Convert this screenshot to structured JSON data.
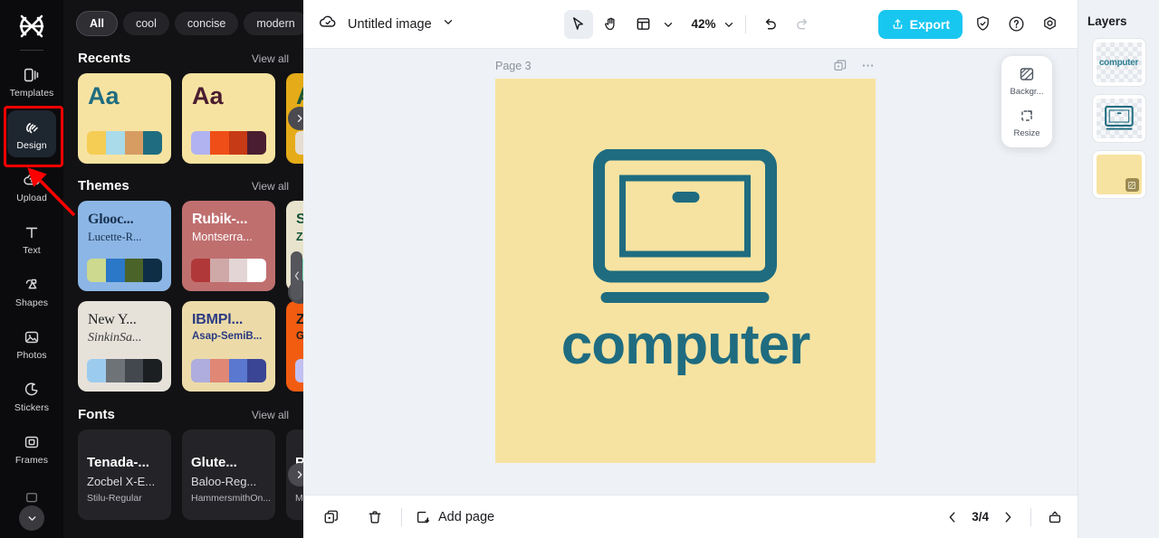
{
  "app": {
    "brand_icon": "capcut-logo-icon"
  },
  "rail": {
    "items": [
      {
        "label": "Templates",
        "icon": "templates-icon",
        "active": false
      },
      {
        "label": "Design",
        "icon": "design-icon",
        "active": true
      },
      {
        "label": "Upload",
        "icon": "upload-cloud-icon",
        "active": false
      },
      {
        "label": "Text",
        "icon": "text-icon",
        "active": false
      },
      {
        "label": "Shapes",
        "icon": "shapes-icon",
        "active": false
      },
      {
        "label": "Photos",
        "icon": "photos-icon",
        "active": false
      },
      {
        "label": "Stickers",
        "icon": "stickers-icon",
        "active": false
      },
      {
        "label": "Frames",
        "icon": "frames-icon",
        "active": false
      }
    ],
    "more_icon": "chevron-down-icon"
  },
  "panel": {
    "chips": [
      {
        "label": "All",
        "selected": true
      },
      {
        "label": "cool",
        "selected": false
      },
      {
        "label": "concise",
        "selected": false
      },
      {
        "label": "modern",
        "selected": false
      }
    ],
    "chip_expand_icon": "chevron-down-icon",
    "sections": {
      "recents": {
        "title": "Recents",
        "view_all": "View all",
        "cards": [
          {
            "sample": "Aa",
            "bg": "#f7e3a1",
            "text_color": "#1f6c80",
            "swatches": [
              "#f5cd54",
              "#a9dbea",
              "#d79c62",
              "#1f6c80"
            ]
          },
          {
            "sample": "Aa",
            "bg": "#f7e3a1",
            "text_color": "#4b1d30",
            "swatches": [
              "#b0b3f0",
              "#f04e18",
              "#c63a16",
              "#4b1d30"
            ]
          },
          {
            "sample": "A",
            "bg": "#e5ab18",
            "text_color": "#1c5637",
            "swatches": [
              "#e6ded2",
              "#e6ded2",
              "#e6ded2",
              "#e6ded2"
            ]
          }
        ]
      },
      "themes": {
        "title": "Themes",
        "view_all": "View all",
        "cards": [
          {
            "name": "Glooc...",
            "sub": "Lucette-R...",
            "bg": "#8cb6e5",
            "name_color": "#17314f",
            "sub_color": "#17314f",
            "serif": true,
            "swatches": [
              "#ccd98e",
              "#2b77c8",
              "#4a6328",
              "#0d2e45"
            ]
          },
          {
            "name": "Rubik-...",
            "sub": "Montserra...",
            "bg": "#c06f6f",
            "name_color": "#ffffff",
            "sub_color": "#ffffff",
            "serif": false,
            "swatches": [
              "#b13838",
              "#cfa8a8",
              "#e3d5d5",
              "#ffffff"
            ]
          },
          {
            "name": "Sp",
            "sub": "ZY",
            "bg": "#e8e3cc",
            "name_color": "#14543a",
            "sub_color": "#14543a",
            "serif": false,
            "swatches": [
              "#77d9b5",
              "#77d9b5",
              "#77d9b5",
              "#77d9b5"
            ]
          },
          {
            "name": "New Y...",
            "sub": "SinkinSa...",
            "bg": "#e6e2da",
            "name_color": "#1d1d1d",
            "sub_color": "#3a3a3a",
            "serif": true,
            "swatches": [
              "#9ccbf0",
              "#6e7378",
              "#43484e",
              "#1c1f22"
            ]
          },
          {
            "name": "IBMPl...",
            "sub": "Asap-SemiB...",
            "bg": "#ecdba9",
            "name_color": "#2b3a82",
            "sub_color": "#2b3a82",
            "serif": false,
            "swatches": [
              "#aeadde",
              "#e08775",
              "#5a78d0",
              "#3a4596"
            ]
          },
          {
            "name": "ZY",
            "sub": "Gro",
            "bg": "#f25c11",
            "name_color": "#1d1d1d",
            "sub_color": "#1d1d1d",
            "serif": false,
            "swatches": [
              "#c2c0f2",
              "#c2c0f2",
              "#c2c0f2",
              "#c2c0f2"
            ]
          }
        ]
      },
      "fonts": {
        "title": "Fonts",
        "view_all": "View all",
        "cards": [
          {
            "line1": "Tenada-...",
            "line2": "Zocbel X-E...",
            "line3": "Stilu-Regular"
          },
          {
            "line1": "Glute...",
            "line2": "Baloo-Reg...",
            "line3": "HammersmithOn..."
          },
          {
            "line1": "Ru",
            "line2": "",
            "line3": "Mor"
          }
        ]
      }
    },
    "collapse_icon": "chevron-left-icon",
    "carousel_next_icon": "chevron-right-icon"
  },
  "topbar": {
    "cloud_icon": "cloud-saved-icon",
    "document_title": "Untitled image",
    "title_caret_icon": "chevron-down-icon",
    "tools": [
      {
        "name": "select-tool",
        "icon": "cursor-arrow-icon",
        "selected": true
      },
      {
        "name": "hand-tool",
        "icon": "hand-icon",
        "selected": false
      },
      {
        "name": "layout-tool",
        "icon": "layout-grid-icon",
        "selected": false
      }
    ],
    "layout_caret_icon": "chevron-down-icon",
    "zoom_level": "42%",
    "zoom_caret_icon": "chevron-down-icon",
    "undo_icon": "undo-icon",
    "redo_icon": "redo-icon",
    "export_label": "Export",
    "export_icon": "export-upload-icon",
    "export_color": "#18c7f0",
    "shield_icon": "shield-check-icon",
    "help_icon": "question-circle-icon",
    "settings_icon": "gear-icon"
  },
  "canvas": {
    "page_label": "Page 3",
    "duplicate_icon": "duplicate-page-icon",
    "more_icon": "more-horizontal-icon",
    "artboard": {
      "background_color": "#f7e3a1",
      "accent_color": "#1f6c80",
      "word": "computer",
      "graphic": "laptop-icon"
    },
    "float_panel": [
      {
        "label": "Backgr...",
        "icon": "background-pattern-icon"
      },
      {
        "label": "Resize",
        "icon": "resize-icon"
      }
    ]
  },
  "bottombar": {
    "duplicate_icon": "duplicate-icon",
    "delete_icon": "trash-icon",
    "add_page_label": "Add page",
    "add_page_icon": "add-page-icon",
    "prev_icon": "chevron-left-icon",
    "page_indicator": "3/4",
    "next_icon": "chevron-right-icon",
    "panel_toggle_icon": "panel-toggle-icon"
  },
  "layers": {
    "title": "Layers",
    "items": [
      {
        "type": "text",
        "label": "computer"
      },
      {
        "type": "graphic",
        "label": "laptop-icon"
      },
      {
        "type": "background",
        "label": "background"
      }
    ]
  },
  "annotation": {
    "highlight_color": "#ff0000",
    "target": "Design"
  }
}
